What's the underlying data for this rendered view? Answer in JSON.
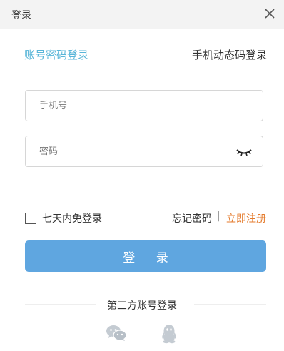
{
  "dialog": {
    "title": "登录"
  },
  "tabs": {
    "password_login": "账号密码登录",
    "sms_login": "手机动态码登录"
  },
  "fields": {
    "phone_placeholder": "手机号",
    "phone_value": "",
    "password_placeholder": "密码",
    "password_value": ""
  },
  "options": {
    "remember_label": "七天内免登录",
    "forgot_label": "忘记密码",
    "separator": "|",
    "register_label": "立即注册"
  },
  "login_button": "登 录",
  "third_party": {
    "label": "第三方账号登录",
    "providers": [
      "wechat-icon",
      "qq-icon"
    ]
  },
  "colors": {
    "active_tab": "#58b5d8",
    "button": "#5fa6e0",
    "register_link": "#e47a2b",
    "titlebar": "#f3f3f3"
  }
}
